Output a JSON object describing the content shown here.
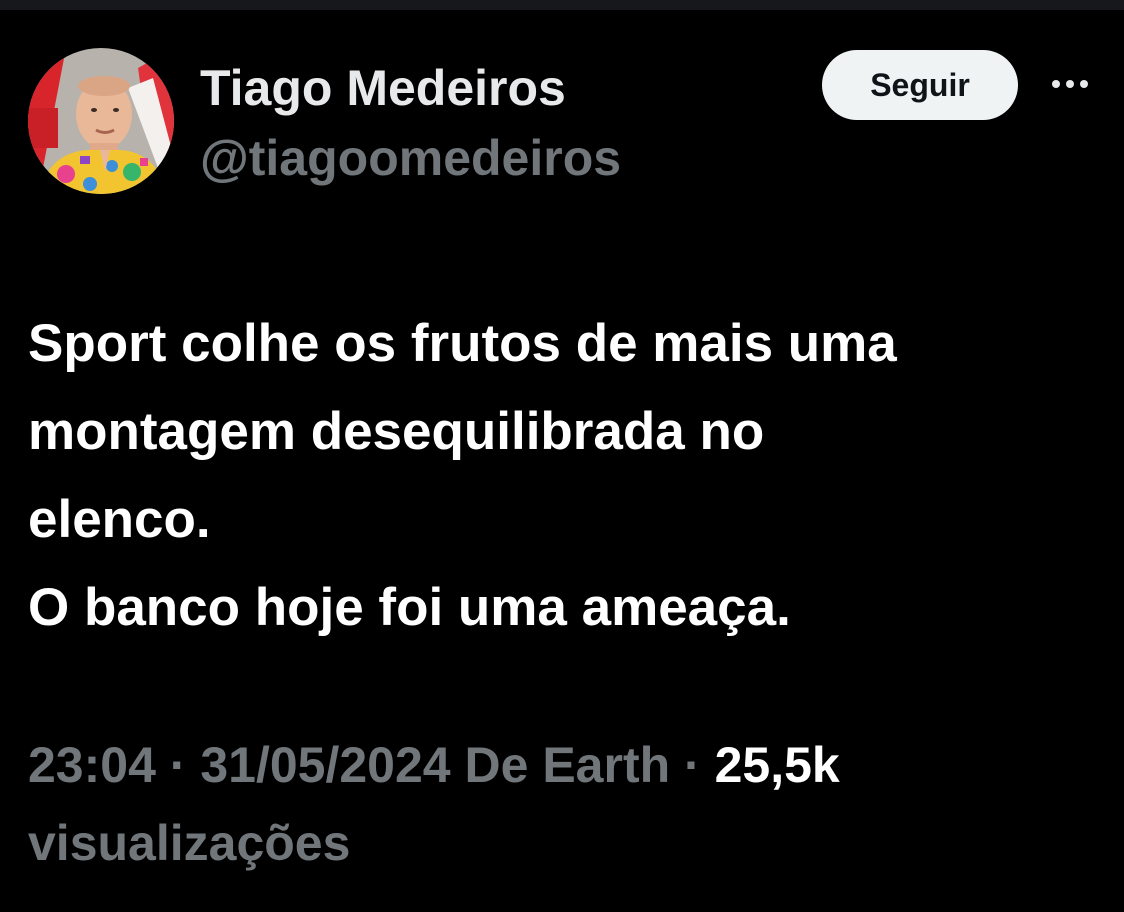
{
  "author": {
    "name": "Tiago Medeiros",
    "handle": "@tiagoomedeiros"
  },
  "actions": {
    "follow_label": "Seguir",
    "more_icon": "more-horizontal-icon"
  },
  "tweet": {
    "lines": [
      "Sport colhe os frutos de mais uma",
      "montagem desequilibrada no",
      "elenco.",
      "O banco hoje foi uma ameaça."
    ]
  },
  "meta": {
    "time": "23:04",
    "separator": "·",
    "date": "31/05/2024",
    "source": "De Earth",
    "views_count": "25,5k",
    "views_label": "visualizações"
  },
  "colors": {
    "background": "#000000",
    "primary_text": "#ffffff",
    "secondary_text": "#71767b",
    "button_bg": "#eff3f4",
    "button_text": "#0f1419"
  }
}
